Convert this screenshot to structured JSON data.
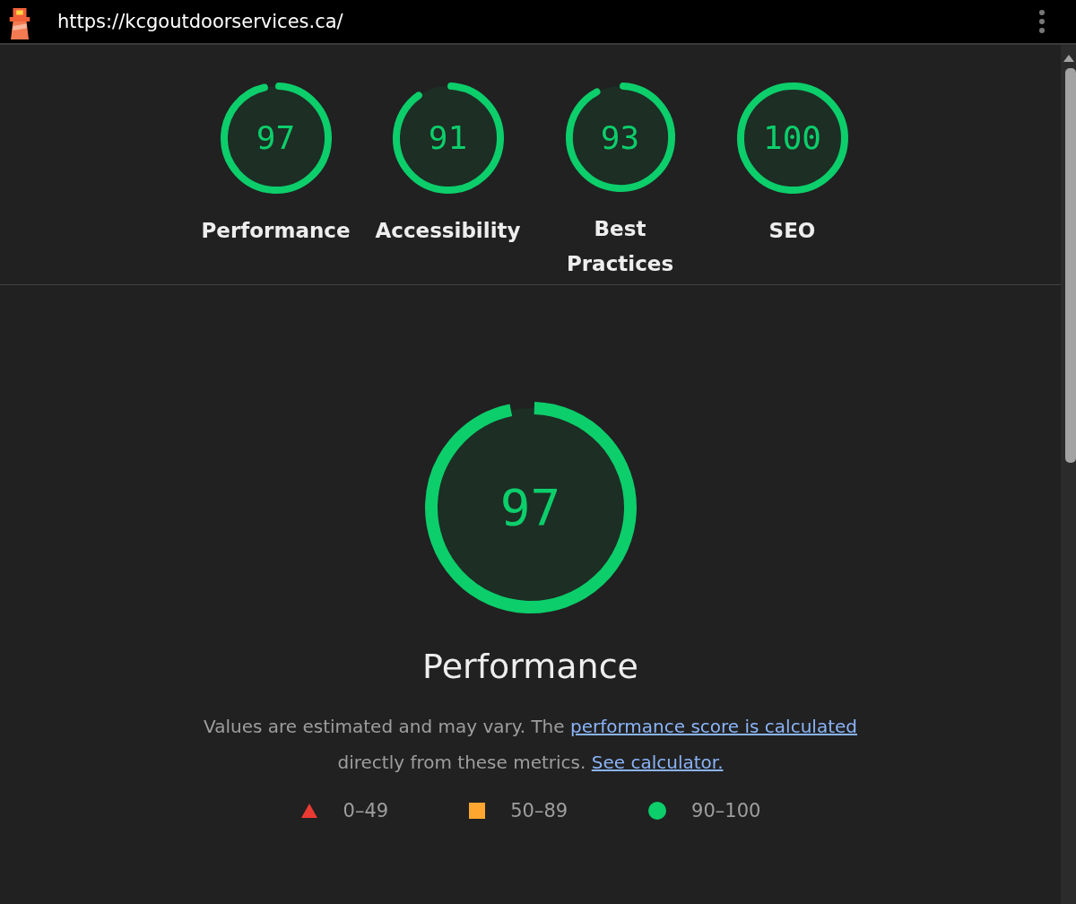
{
  "top_bar": {
    "url": "https://kcgoutdoorservices.ca/"
  },
  "categories": [
    {
      "score": "97",
      "level": 0.97,
      "label": "Performance"
    },
    {
      "score": "91",
      "level": 0.91,
      "label": "Accessibility"
    },
    {
      "score": "93",
      "level": 0.93,
      "label": "Best Practices"
    },
    {
      "score": "100",
      "level": 1,
      "label": "SEO"
    }
  ],
  "main_gauge": {
    "score": "97",
    "level": 0.97,
    "title": "Performance"
  },
  "description": {
    "text": "Values are estimated and may vary. The ",
    "link": "performance score is calculated",
    "text_2": "directly from these metrics.",
    "link_2": "See calculator."
  },
  "legend": [
    {
      "kind": "fail",
      "color": "#eb3a32",
      "range": "0–49"
    },
    {
      "kind": "average",
      "color": "#ffa630",
      "range": "50–89"
    },
    {
      "kind": "pass",
      "color": "#0cce6b",
      "range": "90–100"
    }
  ]
}
